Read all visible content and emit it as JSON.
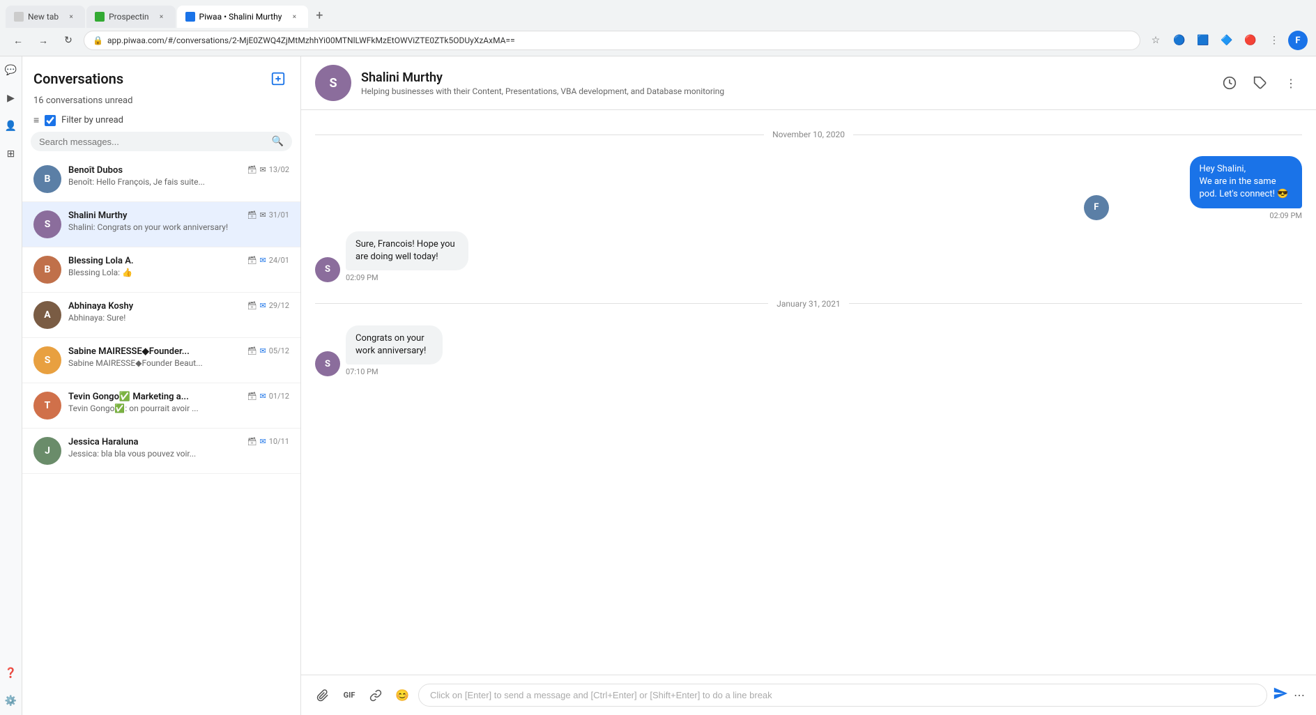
{
  "browser": {
    "tabs": [
      {
        "label": "New tab",
        "active": false,
        "favicon": "🔵"
      },
      {
        "label": "Prospectin",
        "active": false,
        "favicon": "🟢"
      },
      {
        "label": "Piwaa • Shalini Murthy",
        "active": true,
        "favicon": "🔵"
      }
    ],
    "address": "app.piwaa.com/#/conversations/2-MjE0ZWQ4ZjMtMzhhYi00MTNlLWFkMzEtOWViZTE0ZTk5ODUyXzAxMA==",
    "profile_letter": "F"
  },
  "sidebar": {
    "icons": [
      "💬",
      "👥",
      "⊞",
      "❓",
      "⚙️"
    ]
  },
  "conversations": {
    "title": "Conversations",
    "unread_count": "16 conversations unread",
    "filter_label": "Filter by unread",
    "search_placeholder": "Search messages...",
    "items": [
      {
        "name": "Benoît Dubos",
        "preview": "Benoît: Hello François, Je fais suite...",
        "date": "13/02",
        "avatar_color": "#5b7fa6",
        "avatar_letter": "B",
        "has_snooze": true,
        "has_mail": true
      },
      {
        "name": "Shalini Murthy",
        "preview": "Shalini: Congrats on your work anniversary!",
        "date": "31/01",
        "avatar_color": "#8b6d9c",
        "avatar_letter": "S",
        "has_snooze": true,
        "has_mail": true,
        "active": true
      },
      {
        "name": "Blessing Lola A.",
        "preview": "Blessing Lola: 👍",
        "date": "24/01",
        "avatar_color": "#c0704a",
        "avatar_letter": "B",
        "has_snooze": true,
        "has_mail": true
      },
      {
        "name": "Abhinaya Koshy",
        "preview": "Abhinaya: Sure!",
        "date": "29/12",
        "avatar_color": "#7a5c44",
        "avatar_letter": "A",
        "has_snooze": true,
        "has_mail": true
      },
      {
        "name": "Sabine MAIRESSE◆Founder...",
        "preview": "Sabine MAIRESSE◆Founder Beaut...",
        "date": "05/12",
        "avatar_color": "#e8a040",
        "avatar_letter": "S",
        "has_snooze": true,
        "has_mail": true
      },
      {
        "name": "Tevin Gongo✅ Marketing a...",
        "preview": "Tevin Gongo✅: on pourrait avoir ...",
        "date": "01/12",
        "avatar_color": "#d0704a",
        "avatar_letter": "T",
        "has_snooze": true,
        "has_mail": true
      },
      {
        "name": "Jessica Haraluna",
        "preview": "Jessica: bla bla vous pouvez voir...",
        "date": "10/11",
        "avatar_color": "#6a8c6a",
        "avatar_letter": "J",
        "has_snooze": true,
        "has_mail": true
      }
    ]
  },
  "chat": {
    "contact_name": "Shalini Murthy",
    "contact_bio": "Helping businesses with their Content, Presentations, VBA development, and Database monitoring",
    "dates": [
      "November 10, 2020",
      "January 31, 2021"
    ],
    "messages": [
      {
        "type": "outgoing",
        "text": "Hey Shalini,\nWe are in the same pod. Let's connect! 😎",
        "time": "02:09 PM"
      },
      {
        "type": "incoming",
        "text": "Sure, Francois! Hope you are doing well today!",
        "time": "02:09 PM"
      },
      {
        "type": "incoming",
        "text": "Congrats on your work anniversary!",
        "time": "07:10 PM",
        "date_divider": "January 31, 2021"
      }
    ],
    "input_placeholder": "Click on [Enter] to send a message and [Ctrl+Enter] or [Shift+Enter] to do a line break"
  }
}
